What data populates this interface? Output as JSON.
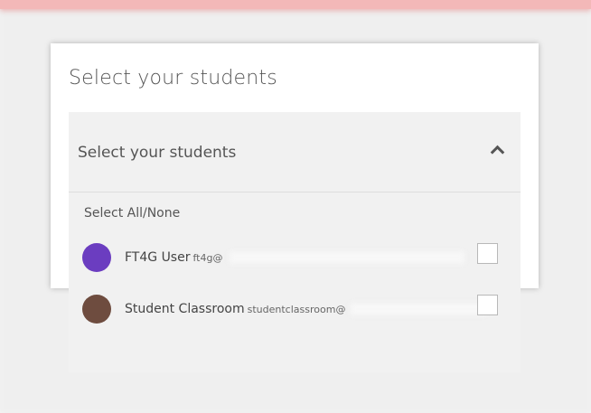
{
  "modal": {
    "title": "Select your students"
  },
  "dropdown": {
    "header_label": "Select your students",
    "select_all_label": "Select All/None",
    "students": [
      {
        "name": "FT4G User",
        "email": "ft4g@",
        "avatar_color": "#6b3dc0",
        "checked": false
      },
      {
        "name": "Student Classroom",
        "email": "studentclassroom@",
        "avatar_color": "#6e4c3f",
        "checked": false
      }
    ]
  },
  "colors": {
    "topbar": "#f3b8b8",
    "panel_bg": "#f1f1f1",
    "modal_bg": "#ffffff"
  }
}
